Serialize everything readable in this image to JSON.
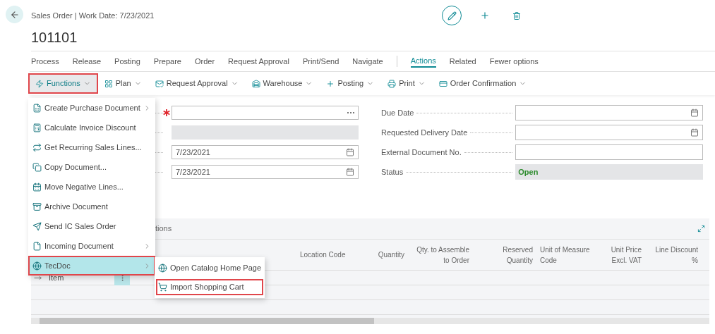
{
  "header": {
    "breadcrumb": "Sales Order | Work Date: 7/23/2021",
    "title": "101101"
  },
  "action_groups": [
    {
      "label": "Process",
      "selected": false
    },
    {
      "label": "Release",
      "selected": false
    },
    {
      "label": "Posting",
      "selected": false
    },
    {
      "label": "Prepare",
      "selected": false
    },
    {
      "label": "Order",
      "selected": false
    },
    {
      "label": "Request Approval",
      "selected": false
    },
    {
      "label": "Print/Send",
      "selected": false
    },
    {
      "label": "Navigate",
      "selected": false
    }
  ],
  "view_tabs": [
    {
      "label": "Actions",
      "selected": true
    },
    {
      "label": "Related",
      "selected": false
    },
    {
      "label": "Fewer options",
      "selected": false
    }
  ],
  "toolbar": [
    {
      "label": "Functions",
      "selected": true,
      "highlighted": true
    },
    {
      "label": "Plan",
      "selected": false,
      "highlighted": false
    },
    {
      "label": "Request Approval",
      "selected": false,
      "highlighted": false
    },
    {
      "label": "Warehouse",
      "selected": false,
      "highlighted": false
    },
    {
      "label": "Posting",
      "selected": false,
      "highlighted": false
    },
    {
      "label": "Print",
      "selected": false,
      "highlighted": false
    },
    {
      "label": "Order Confirmation",
      "selected": false,
      "highlighted": false
    }
  ],
  "functions_menu": [
    {
      "label": "Create Purchase Document",
      "has_submenu": true,
      "selected": false,
      "highlighted": false
    },
    {
      "label": "Calculate Invoice Discount",
      "has_submenu": false,
      "selected": false,
      "highlighted": false
    },
    {
      "label": "Get Recurring Sales Lines...",
      "has_submenu": false,
      "selected": false,
      "highlighted": false
    },
    {
      "label": "Copy Document...",
      "has_submenu": false,
      "selected": false,
      "highlighted": false
    },
    {
      "label": "Move Negative Lines...",
      "has_submenu": false,
      "selected": false,
      "highlighted": false
    },
    {
      "label": "Archive Document",
      "has_submenu": false,
      "selected": false,
      "highlighted": false
    },
    {
      "label": "Send IC Sales Order",
      "has_submenu": false,
      "selected": false,
      "highlighted": false
    },
    {
      "label": "Incoming Document",
      "has_submenu": true,
      "selected": false,
      "highlighted": false
    },
    {
      "label": "TecDoc",
      "has_submenu": true,
      "selected": true,
      "highlighted": true
    }
  ],
  "tecdoc_submenu": [
    {
      "label": "Open Catalog Home Page",
      "highlighted": false
    },
    {
      "label": "Import Shopping Cart",
      "highlighted": true
    }
  ],
  "form_left": [
    {
      "kind": "lookup",
      "required": true
    },
    {
      "kind": "readonly",
      "required": false
    },
    {
      "kind": "date",
      "value": "7/23/2021",
      "required": false
    },
    {
      "kind": "date",
      "value": "7/23/2021",
      "required": false
    }
  ],
  "form_right": [
    {
      "label": "Due Date",
      "kind": "date"
    },
    {
      "label": "Requested Delivery Date",
      "kind": "date"
    },
    {
      "label": "External Document No.",
      "kind": "text"
    },
    {
      "label": "Status",
      "kind": "status",
      "value": "Open"
    }
  ],
  "lines": {
    "title": "tions",
    "columns": [
      "Location Code",
      "Quantity",
      "Qty. to Assemble to Order",
      "Reserved Quantity",
      "Unit of Measure Code",
      "Unit Price Excl. VAT",
      "Line Discount %"
    ],
    "rows": [
      {
        "type": "Item",
        "selected": true
      }
    ]
  }
}
